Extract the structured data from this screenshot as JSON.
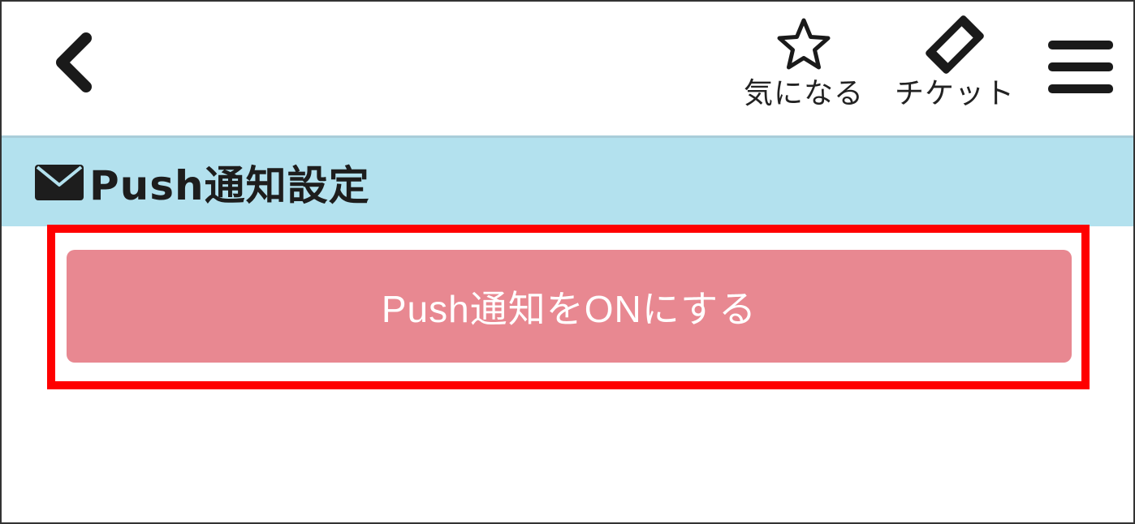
{
  "header": {
    "back_icon": "chevron-left-icon",
    "favorite": {
      "icon": "star-outline-icon",
      "label": "気になる"
    },
    "ticket": {
      "icon": "ticket-icon",
      "label": "チケット"
    },
    "menu_icon": "hamburger-menu-icon"
  },
  "section": {
    "icon": "envelope-icon",
    "title": "Push通知設定"
  },
  "push_button": {
    "label": "Push通知をONにする",
    "color": "#e88891"
  },
  "colors": {
    "section_bar": "#b3e1ee",
    "highlight": "#ff0000",
    "text": "#222222"
  }
}
